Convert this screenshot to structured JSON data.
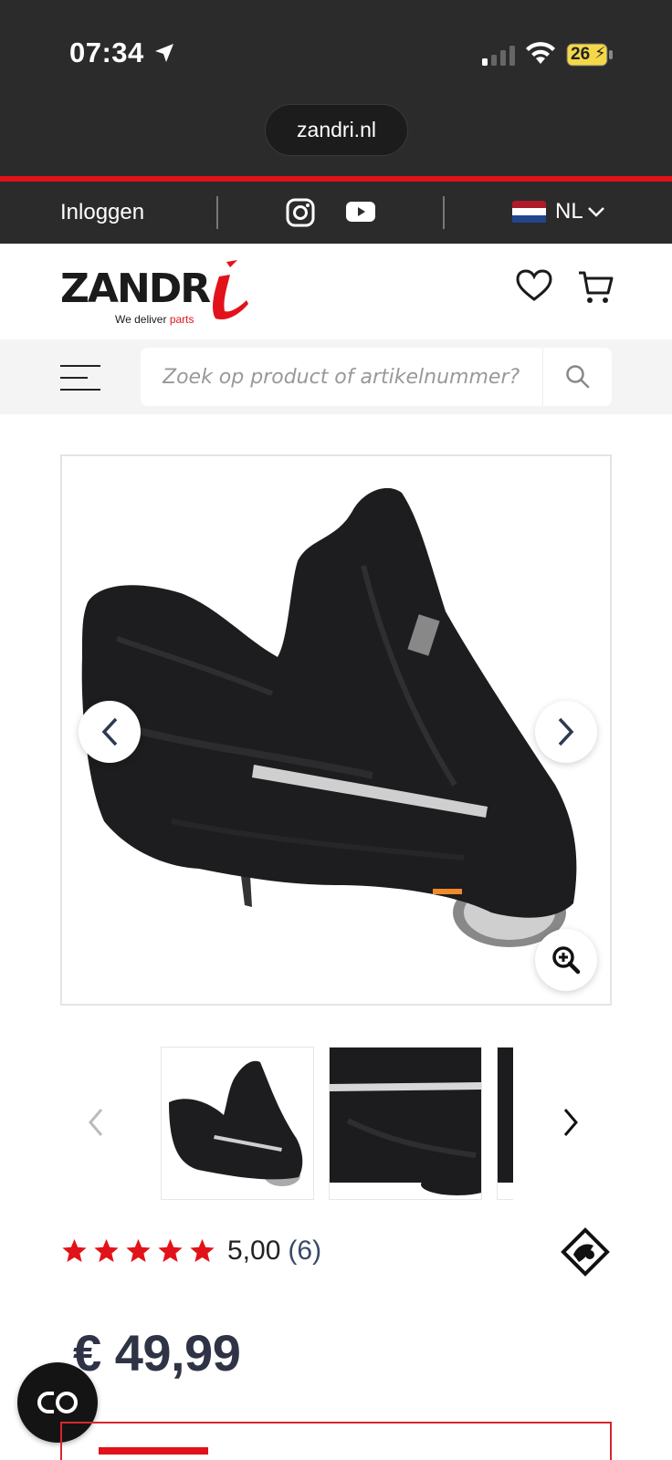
{
  "status_bar": {
    "time": "07:34",
    "battery": "26",
    "icons": [
      "location-arrow-icon",
      "cellular-signal-icon",
      "wifi-icon",
      "battery-charging-icon"
    ]
  },
  "browser": {
    "url": "zandri.nl"
  },
  "topbar": {
    "login_label": "Inloggen",
    "social": [
      "instagram-icon",
      "youtube-icon"
    ],
    "language": "NL"
  },
  "header": {
    "logo_text": "ZANDR",
    "logo_tagline_prefix": "We deliver ",
    "logo_tagline_suffix": "parts",
    "icons": [
      "heart-icon",
      "cart-icon"
    ]
  },
  "search": {
    "placeholder": "Zoek op product of artikelnummer?"
  },
  "gallery": {
    "alt": "Tucano Urbano scooter cover",
    "thumbnail_count_visible": 3
  },
  "rating": {
    "stars": 5,
    "score": "5,00",
    "count": "(6)"
  },
  "product": {
    "price": "€ 49,99"
  },
  "colors": {
    "brand_red": "#e2121b",
    "dark_bar": "#2b2b2b",
    "price_text": "#2e3445"
  }
}
